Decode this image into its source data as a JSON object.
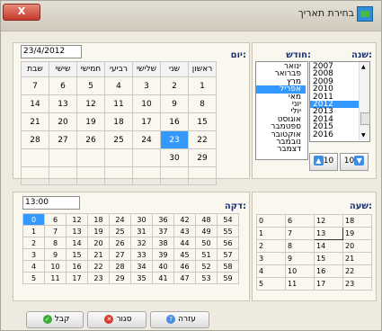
{
  "window": {
    "title": "בחירת תאריך",
    "close_label": "X"
  },
  "year": {
    "label": "שנה:",
    "items": [
      "2007",
      "2008",
      "2009",
      "2010",
      "2011",
      "2012",
      "2013",
      "2014",
      "2015",
      "2016"
    ],
    "selected_index": 5,
    "prev_label": "10",
    "next_label": "10"
  },
  "month": {
    "label": "חודש:",
    "items": [
      "ינואר",
      "פברואר",
      "מרץ",
      "אפריל",
      "מאי",
      "יוני",
      "יולי",
      "אוגוסט",
      "ספטמבר",
      "אוקטובר",
      "נובמבר",
      "דצמבר"
    ],
    "selected_index": 3
  },
  "day": {
    "label": "יום:",
    "date_value": "23/4/2012",
    "weekdays": [
      "ראשון",
      "שני",
      "שלישי",
      "רביעי",
      "חמישי",
      "שישי",
      "שבת"
    ],
    "weeks": [
      [
        "1",
        "2",
        "3",
        "4",
        "5",
        "6",
        "7"
      ],
      [
        "8",
        "9",
        "10",
        "11",
        "12",
        "13",
        "14"
      ],
      [
        "15",
        "16",
        "17",
        "18",
        "19",
        "20",
        "21"
      ],
      [
        "22",
        "23",
        "24",
        "25",
        "26",
        "27",
        "28"
      ],
      [
        "29",
        "30",
        "",
        "",
        "",
        "",
        ""
      ],
      [
        "",
        "",
        "",
        "",
        "",
        "",
        ""
      ]
    ],
    "selected": "23"
  },
  "minute": {
    "label": "דקה:",
    "time_value": "13:00",
    "rows": [
      [
        "0",
        "6",
        "12",
        "18",
        "24",
        "30",
        "36",
        "42",
        "48",
        "54"
      ],
      [
        "1",
        "7",
        "13",
        "19",
        "25",
        "31",
        "37",
        "43",
        "49",
        "55"
      ],
      [
        "2",
        "8",
        "14",
        "20",
        "26",
        "32",
        "38",
        "44",
        "50",
        "56"
      ],
      [
        "3",
        "9",
        "15",
        "21",
        "27",
        "33",
        "39",
        "45",
        "51",
        "57"
      ],
      [
        "4",
        "10",
        "16",
        "22",
        "28",
        "34",
        "40",
        "46",
        "52",
        "58"
      ],
      [
        "5",
        "11",
        "17",
        "23",
        "29",
        "35",
        "41",
        "47",
        "53",
        "59"
      ]
    ],
    "selected": "0"
  },
  "hour": {
    "label": "שעה:",
    "rows": [
      [
        "0",
        "6",
        "12",
        "18"
      ],
      [
        "1",
        "7",
        "13",
        "19"
      ],
      [
        "2",
        "8",
        "14",
        "20"
      ],
      [
        "3",
        "9",
        "15",
        "21"
      ],
      [
        "4",
        "10",
        "16",
        "22"
      ],
      [
        "5",
        "11",
        "17",
        "23"
      ]
    ],
    "current": "13"
  },
  "buttons": {
    "ok": "קבל",
    "close": "סגור",
    "help": "עזרה"
  },
  "colors": {
    "selected": "#3399ff",
    "label": "#1b2f73"
  }
}
